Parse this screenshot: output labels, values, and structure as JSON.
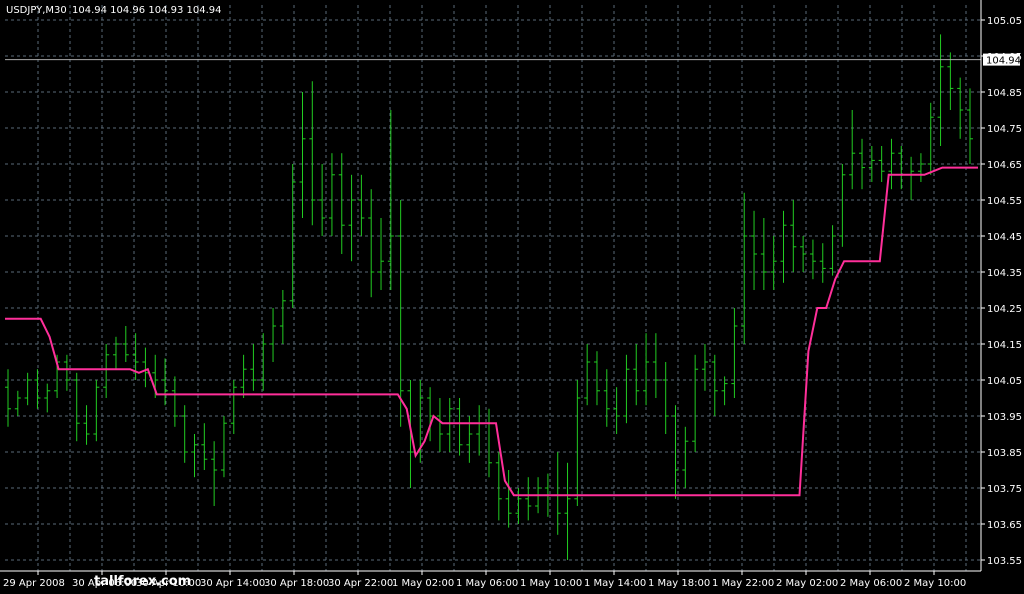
{
  "header": {
    "symbol_timeframe": "USDJPY,M30",
    "ohlc": "104.94 104.96 104.93 104.94"
  },
  "price_label": "104.94",
  "watermark": "tallforex.com",
  "colors": {
    "background": "#000000",
    "grid": "#5a6a78",
    "bars": "#22cc22",
    "indicator": "#ff2f9a",
    "axis_text": "#ffffff",
    "bid_line": "#aaaaaa"
  },
  "chart_data": {
    "type": "line",
    "title": "USDJPY,M30",
    "xlabel": "",
    "ylabel": "",
    "ylim": [
      103.5,
      105.1
    ],
    "grid": true,
    "y_ticks": [
      "105.05",
      "104.95",
      "104.85",
      "104.75",
      "104.65",
      "104.55",
      "104.45",
      "104.35",
      "104.25",
      "104.15",
      "104.05",
      "103.95",
      "103.85",
      "103.75",
      "103.65",
      "103.55"
    ],
    "x_ticks": [
      "29 Apr 2008",
      "30 Apr 06:00",
      "30 Apr 10:00",
      "30 Apr 14:00",
      "30 Apr 18:00",
      "30 Apr 22:00",
      "1 May 02:00",
      "1 May 06:00",
      "1 May 10:00",
      "1 May 14:00",
      "1 May 18:00",
      "1 May 22:00",
      "2 May 02:00",
      "2 May 06:00",
      "2 May 10:00"
    ],
    "last_price": 104.94,
    "bars": [
      [
        104.03,
        104.08,
        103.92,
        103.97
      ],
      [
        103.97,
        104.02,
        103.95,
        104.0
      ],
      [
        104.0,
        104.07,
        103.98,
        104.05
      ],
      [
        104.05,
        104.08,
        103.97,
        104.0
      ],
      [
        104.0,
        104.04,
        103.96,
        104.02
      ],
      [
        104.02,
        104.12,
        104.0,
        104.1
      ],
      [
        104.1,
        104.12,
        104.02,
        104.05
      ],
      [
        104.05,
        104.07,
        103.88,
        103.93
      ],
      [
        103.93,
        103.98,
        103.87,
        103.9
      ],
      [
        103.9,
        104.05,
        103.88,
        104.03
      ],
      [
        104.03,
        104.15,
        104.0,
        104.12
      ],
      [
        104.12,
        104.17,
        104.08,
        104.15
      ],
      [
        104.15,
        104.2,
        104.1,
        104.12
      ],
      [
        104.12,
        104.18,
        104.05,
        104.1
      ],
      [
        104.1,
        104.14,
        104.03,
        104.07
      ],
      [
        104.07,
        104.12,
        104.0,
        104.05
      ],
      [
        104.05,
        104.11,
        103.98,
        104.02
      ],
      [
        104.02,
        104.06,
        103.92,
        103.95
      ],
      [
        103.95,
        103.98,
        103.82,
        103.85
      ],
      [
        103.85,
        103.9,
        103.78,
        103.87
      ],
      [
        103.87,
        103.93,
        103.8,
        103.83
      ],
      [
        103.83,
        103.88,
        103.7,
        103.8
      ],
      [
        103.8,
        103.95,
        103.78,
        103.93
      ],
      [
        103.93,
        104.05,
        103.9,
        104.03
      ],
      [
        104.03,
        104.12,
        104.0,
        104.08
      ],
      [
        104.08,
        104.15,
        104.02,
        104.05
      ],
      [
        104.05,
        104.18,
        104.02,
        104.15
      ],
      [
        104.15,
        104.25,
        104.1,
        104.2
      ],
      [
        104.2,
        104.3,
        104.15,
        104.27
      ],
      [
        104.27,
        104.65,
        104.25,
        104.6
      ],
      [
        104.6,
        104.85,
        104.5,
        104.72
      ],
      [
        104.72,
        104.88,
        104.48,
        104.55
      ],
      [
        104.55,
        104.65,
        104.45,
        104.5
      ],
      [
        104.5,
        104.68,
        104.45,
        104.62
      ],
      [
        104.62,
        104.68,
        104.4,
        104.48
      ],
      [
        104.48,
        104.62,
        104.38,
        104.55
      ],
      [
        104.55,
        104.62,
        104.45,
        104.5
      ],
      [
        104.5,
        104.58,
        104.28,
        104.35
      ],
      [
        104.35,
        104.5,
        104.3,
        104.38
      ],
      [
        104.38,
        104.8,
        104.3,
        104.45
      ],
      [
        104.45,
        104.55,
        103.92,
        104.02
      ],
      [
        104.02,
        104.05,
        103.75,
        103.85
      ],
      [
        103.85,
        104.05,
        103.82,
        104.0
      ],
      [
        104.0,
        104.03,
        103.88,
        103.95
      ],
      [
        103.95,
        104.0,
        103.85,
        103.9
      ],
      [
        103.9,
        104.0,
        103.85,
        103.97
      ],
      [
        103.97,
        104.0,
        103.84,
        103.87
      ],
      [
        103.87,
        103.95,
        103.82,
        103.9
      ],
      [
        103.9,
        103.98,
        103.84,
        103.93
      ],
      [
        103.93,
        103.97,
        103.78,
        103.82
      ],
      [
        103.82,
        103.85,
        103.66,
        103.72
      ],
      [
        103.72,
        103.8,
        103.64,
        103.68
      ],
      [
        103.68,
        103.75,
        103.65,
        103.72
      ],
      [
        103.72,
        103.78,
        103.66,
        103.7
      ],
      [
        103.7,
        103.78,
        103.68,
        103.75
      ],
      [
        103.75,
        103.79,
        103.67,
        103.73
      ],
      [
        103.73,
        103.85,
        103.62,
        103.68
      ],
      [
        103.68,
        103.82,
        103.55,
        103.72
      ],
      [
        103.72,
        104.05,
        103.7,
        104.0
      ],
      [
        104.0,
        104.15,
        103.98,
        104.1
      ],
      [
        104.1,
        104.13,
        103.98,
        104.02
      ],
      [
        104.02,
        104.08,
        103.92,
        103.97
      ],
      [
        103.97,
        104.03,
        103.9,
        103.95
      ],
      [
        103.95,
        104.12,
        103.93,
        104.08
      ],
      [
        104.08,
        104.15,
        103.98,
        104.02
      ],
      [
        104.02,
        104.18,
        103.98,
        104.1
      ],
      [
        104.1,
        104.18,
        104.0,
        104.05
      ],
      [
        104.05,
        104.1,
        103.9,
        103.95
      ],
      [
        103.95,
        103.98,
        103.72,
        103.8
      ],
      [
        103.8,
        103.92,
        103.75,
        103.88
      ],
      [
        103.88,
        104.12,
        103.85,
        104.08
      ],
      [
        104.08,
        104.15,
        104.02,
        104.1
      ],
      [
        104.1,
        104.12,
        103.95,
        104.02
      ],
      [
        104.02,
        104.06,
        103.98,
        104.04
      ],
      [
        104.04,
        104.25,
        104.0,
        104.2
      ],
      [
        104.2,
        104.57,
        104.15,
        104.45
      ],
      [
        104.45,
        104.52,
        104.3,
        104.4
      ],
      [
        104.4,
        104.5,
        104.3,
        104.35
      ],
      [
        104.35,
        104.45,
        104.3,
        104.38
      ],
      [
        104.38,
        104.52,
        104.32,
        104.48
      ],
      [
        104.48,
        104.55,
        104.35,
        104.42
      ],
      [
        104.42,
        104.45,
        104.35,
        104.4
      ],
      [
        104.4,
        104.44,
        104.33,
        104.38
      ],
      [
        104.38,
        104.43,
        104.32,
        104.36
      ],
      [
        104.36,
        104.48,
        104.34,
        104.45
      ],
      [
        104.45,
        104.65,
        104.42,
        104.62
      ],
      [
        104.62,
        104.8,
        104.58,
        104.68
      ],
      [
        104.68,
        104.72,
        104.58,
        104.64
      ],
      [
        104.64,
        104.7,
        104.6,
        104.66
      ],
      [
        104.66,
        104.7,
        104.6,
        104.63
      ],
      [
        104.63,
        104.72,
        104.58,
        104.68
      ],
      [
        104.68,
        104.7,
        104.58,
        104.62
      ],
      [
        104.62,
        104.67,
        104.55,
        104.63
      ],
      [
        104.63,
        104.68,
        104.6,
        104.65
      ],
      [
        104.65,
        104.82,
        104.62,
        104.78
      ],
      [
        104.78,
        105.01,
        104.7,
        104.92
      ],
      [
        104.92,
        104.96,
        104.8,
        104.86
      ],
      [
        104.86,
        104.89,
        104.72,
        104.8
      ],
      [
        104.8,
        104.86,
        104.65,
        104.72
      ]
    ],
    "series": [
      {
        "values": [
          104.22,
          104.22,
          104.22,
          104.22,
          104.22,
          104.17,
          104.08,
          104.08,
          104.08,
          104.08,
          104.08,
          104.08,
          104.08,
          104.08,
          104.08,
          104.07,
          104.08,
          104.01,
          104.01,
          104.01,
          104.01,
          104.01,
          104.01,
          104.01,
          104.01,
          104.01,
          104.01,
          104.01,
          104.01,
          104.01,
          104.01,
          104.01,
          104.01,
          104.01,
          104.01,
          104.01,
          104.01,
          104.01,
          104.01,
          104.01,
          104.01,
          104.01,
          104.01,
          104.01,
          104.01,
          103.97,
          103.84,
          103.88,
          103.95,
          103.93,
          103.93,
          103.93,
          103.93,
          103.93,
          103.93,
          103.93,
          103.77,
          103.73,
          103.73,
          103.73,
          103.73,
          103.73,
          103.73,
          103.73,
          103.73,
          103.73,
          103.73,
          103.73,
          103.73,
          103.73,
          103.73,
          103.73,
          103.73,
          103.73,
          103.73,
          103.73,
          103.73,
          103.73,
          103.73,
          103.73,
          103.73,
          103.73,
          103.73,
          103.73,
          103.73,
          103.73,
          103.73,
          103.73,
          103.73,
          103.73,
          104.13,
          104.25,
          104.25,
          104.33,
          104.38,
          104.38,
          104.38,
          104.38,
          104.38,
          104.62,
          104.62,
          104.62,
          104.62,
          104.62,
          104.63,
          104.64,
          104.64,
          104.64,
          104.64,
          104.64
        ]
      }
    ]
  }
}
